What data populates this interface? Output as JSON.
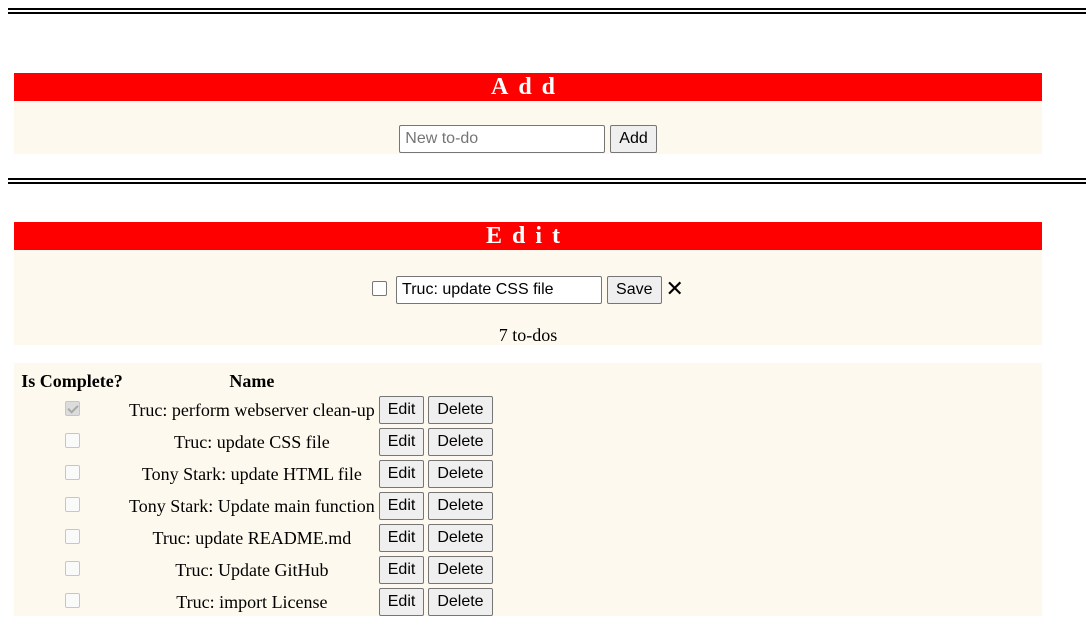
{
  "add": {
    "header": "Add",
    "input_placeholder": "New to-do",
    "button_label": "Add"
  },
  "edit": {
    "header": "Edit",
    "checkbox_checked": false,
    "input_value": "Truc: update CSS file",
    "save_label": "Save",
    "close_glyph": "✕",
    "count_text": "7 to-dos"
  },
  "table": {
    "headers": [
      "Is Complete?",
      "Name"
    ],
    "edit_label": "Edit",
    "delete_label": "Delete",
    "rows": [
      {
        "complete": true,
        "name": "Truc: perform webserver clean-up"
      },
      {
        "complete": false,
        "name": "Truc: update CSS file"
      },
      {
        "complete": false,
        "name": "Tony Stark: update HTML file"
      },
      {
        "complete": false,
        "name": "Tony Stark: Update main function"
      },
      {
        "complete": false,
        "name": "Truc: update README.md"
      },
      {
        "complete": false,
        "name": "Truc: Update GitHub"
      },
      {
        "complete": false,
        "name": "Truc: import License"
      }
    ]
  },
  "colors": {
    "header_bg": "#ff0000",
    "header_text": "#ffffff",
    "panel_bg": "#fdf9ee"
  }
}
